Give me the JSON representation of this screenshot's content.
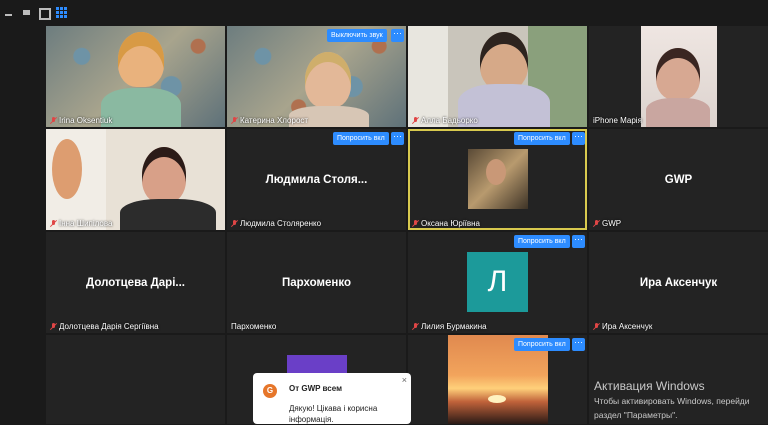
{
  "window": {
    "controls": [
      "minimize-icon",
      "restore-icon",
      "fullscreen-icon",
      "gallery-view-icon"
    ],
    "accent": "#2d8cff"
  },
  "tiles": {
    "t1": {
      "name": "Irina Oksentiuk",
      "muted": true
    },
    "t2": {
      "name": "Катерина Хлорост",
      "muted": true,
      "button": "Выключить звук"
    },
    "t3": {
      "name": "Алла Бадьорко",
      "muted": true
    },
    "t4": {
      "name": "iPhone Марія",
      "muted": false
    },
    "t5": {
      "name": "Інна Шипілова",
      "muted": true
    },
    "t6": {
      "name": "Людмила Столяренко",
      "display": "Людмила  Столя...",
      "muted": true,
      "button": "Попросить вкл"
    },
    "t7": {
      "name": "Оксана Юріївна",
      "muted": true,
      "button": "Попросить вкл"
    },
    "t8": {
      "name": "GWP",
      "display": "GWP",
      "muted": true
    },
    "t9": {
      "name": "Долотцева Дарія Сергіївна",
      "display": "Долотцева  Дарі...",
      "muted": true
    },
    "t10": {
      "name": "Пархоменко",
      "display": "Пархоменко",
      "muted": false
    },
    "t11": {
      "name": "Лилия Бурмакина",
      "initial": "Л",
      "muted": true,
      "button": "Попросить вкл"
    },
    "t12": {
      "name": "Ира Аксенчук",
      "display": "Ира Аксенчук",
      "muted": true
    },
    "t15": {
      "button": "Попросить вкл"
    }
  },
  "more_label": "···",
  "chat": {
    "avatar": "G",
    "from": "От GWP всем",
    "message": "Дякую! Цікава і корисна інформація.",
    "close": "×"
  },
  "activation": {
    "title": "Активация Windows",
    "line1": "Чтобы активировать Windows, перейди",
    "line2": "раздел \"Параметры\"."
  }
}
